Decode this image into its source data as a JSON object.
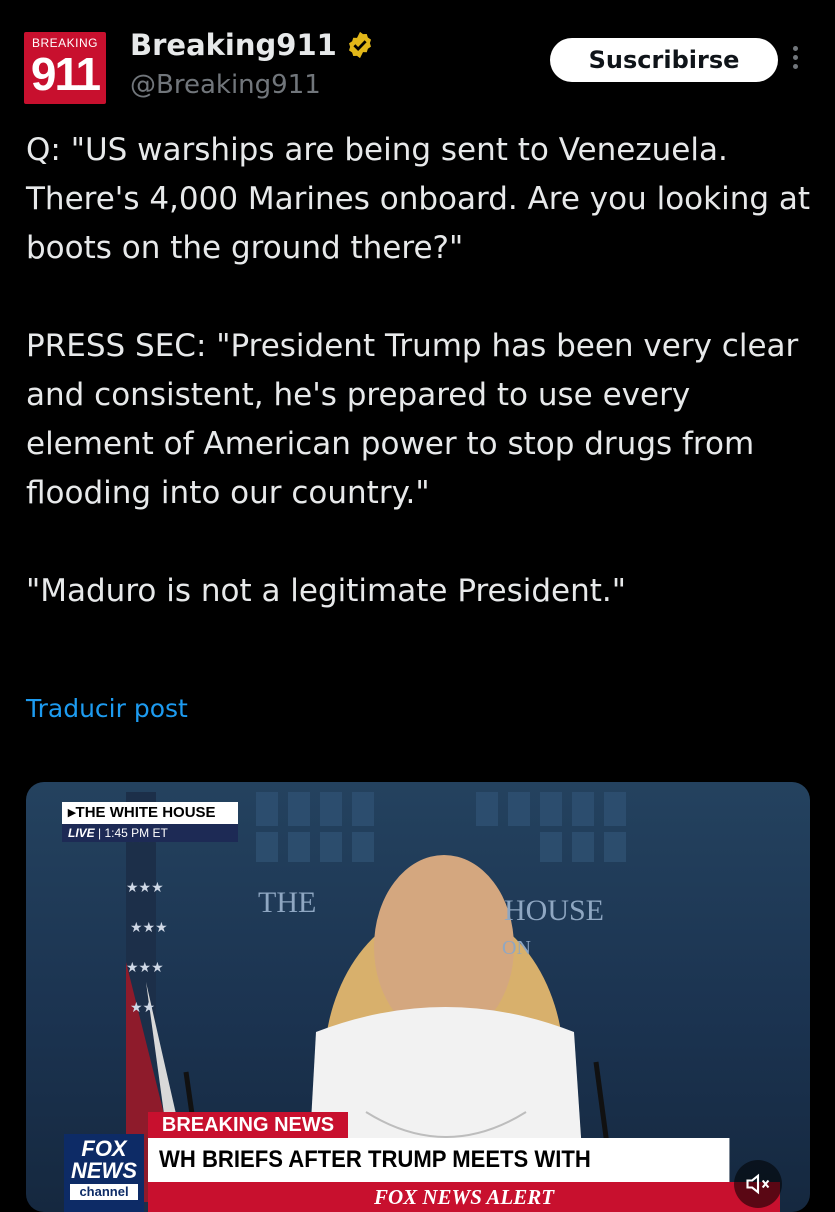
{
  "header": {
    "avatar": {
      "top_text": "BREAKING",
      "number": "911"
    },
    "name": "Breaking911",
    "handle": "@Breaking911",
    "subscribe_label": "Suscribirse",
    "more_icon": "more-vertical-icon"
  },
  "tweet": {
    "text": "Q: \"US warships are being sent to Venezuela. There's 4,000 Marines onboard. Are you looking at boots on the ground there?\"\n\nPRESS SEC: \"President Trump has been very clear and consistent, he's prepared to use every element of American power to stop drugs from flooding into our country.\"\n\n\"Maduro is not a legitimate President.\"",
    "translate_label": "Traducir post"
  },
  "media": {
    "backdrop_text_left": "THE",
    "backdrop_text_right": "HOUSE",
    "backdrop_text_sub": "ON",
    "location_label": "THE WHITE HOUSE",
    "live_label": "LIVE",
    "time_label": "1:45 PM ET",
    "breaking_label": "BREAKING NEWS",
    "headline": "WH BRIEFS AFTER TRUMP MEETS WITH ZELENSKYY, PUTIN",
    "alert_label": "FOX NEWS ALERT",
    "network_logo": {
      "line1": "FOX",
      "line2": "NEWS",
      "line3": "channel"
    },
    "mute_icon": "volume-muted-icon"
  },
  "colors": {
    "background": "#000000",
    "text": "#e7e9ea",
    "secondary_text": "#71767b",
    "link": "#1d9bf0",
    "verified": "#e2b719",
    "fox_red": "#c8102e",
    "fox_blue": "#0d2b66"
  }
}
